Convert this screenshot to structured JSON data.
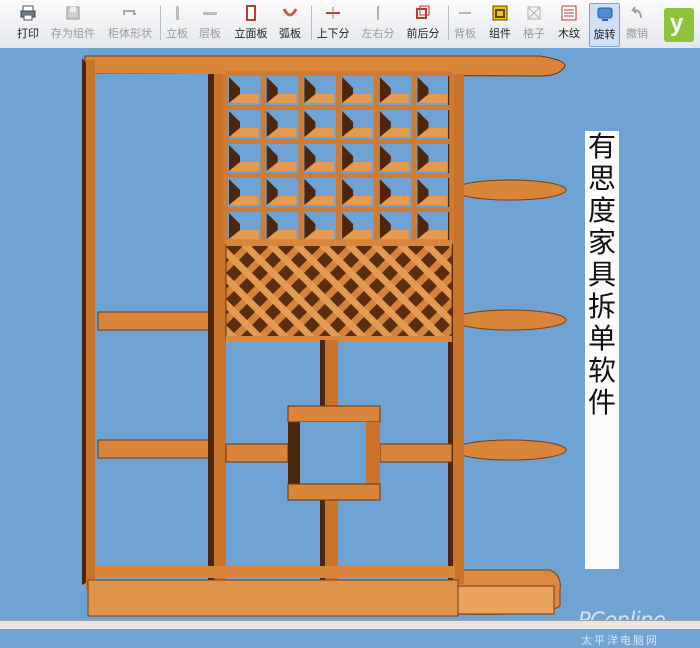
{
  "toolbar": {
    "items": [
      {
        "label": "打印",
        "icon": "printer-icon",
        "enabled": true
      },
      {
        "label": "存为组件",
        "icon": "save-component-icon",
        "enabled": false
      },
      {
        "label": "柜体形状",
        "icon": "cabinet-shape-icon",
        "enabled": false
      },
      {
        "label": "立板",
        "icon": "vertical-board-icon",
        "enabled": false
      },
      {
        "label": "层板",
        "icon": "shelf-board-icon",
        "enabled": false
      },
      {
        "label": "立面板",
        "icon": "front-panel-icon",
        "enabled": true
      },
      {
        "label": "弧板",
        "icon": "arc-board-icon",
        "enabled": true
      },
      {
        "label": "上下分",
        "icon": "split-vertical-icon",
        "enabled": true
      },
      {
        "label": "左右分",
        "icon": "split-horizontal-icon",
        "enabled": false
      },
      {
        "label": "前后分",
        "icon": "split-depth-icon",
        "enabled": true
      },
      {
        "label": "背板",
        "icon": "back-board-icon",
        "enabled": false
      },
      {
        "label": "组件",
        "icon": "component-icon",
        "enabled": true
      },
      {
        "label": "格子",
        "icon": "grid-icon",
        "enabled": false
      },
      {
        "label": "木纹",
        "icon": "wood-grain-icon",
        "enabled": true
      },
      {
        "label": "旋转",
        "icon": "rotate-icon",
        "enabled": true,
        "active": true
      },
      {
        "label": "撤销",
        "icon": "undo-icon",
        "enabled": false
      }
    ]
  },
  "title": [
    "有",
    "思",
    "度",
    "家",
    "具",
    "拆",
    "单",
    "软",
    "件"
  ],
  "watermark": {
    "brand": "PConline",
    "subtitle": "太平洋电脑网"
  },
  "colors": {
    "background": "#6fa3d4",
    "wood": "#cf7b32",
    "wood_light": "#e49a4f",
    "wood_dark": "#4e260c",
    "accent": "#7aa0d6"
  }
}
